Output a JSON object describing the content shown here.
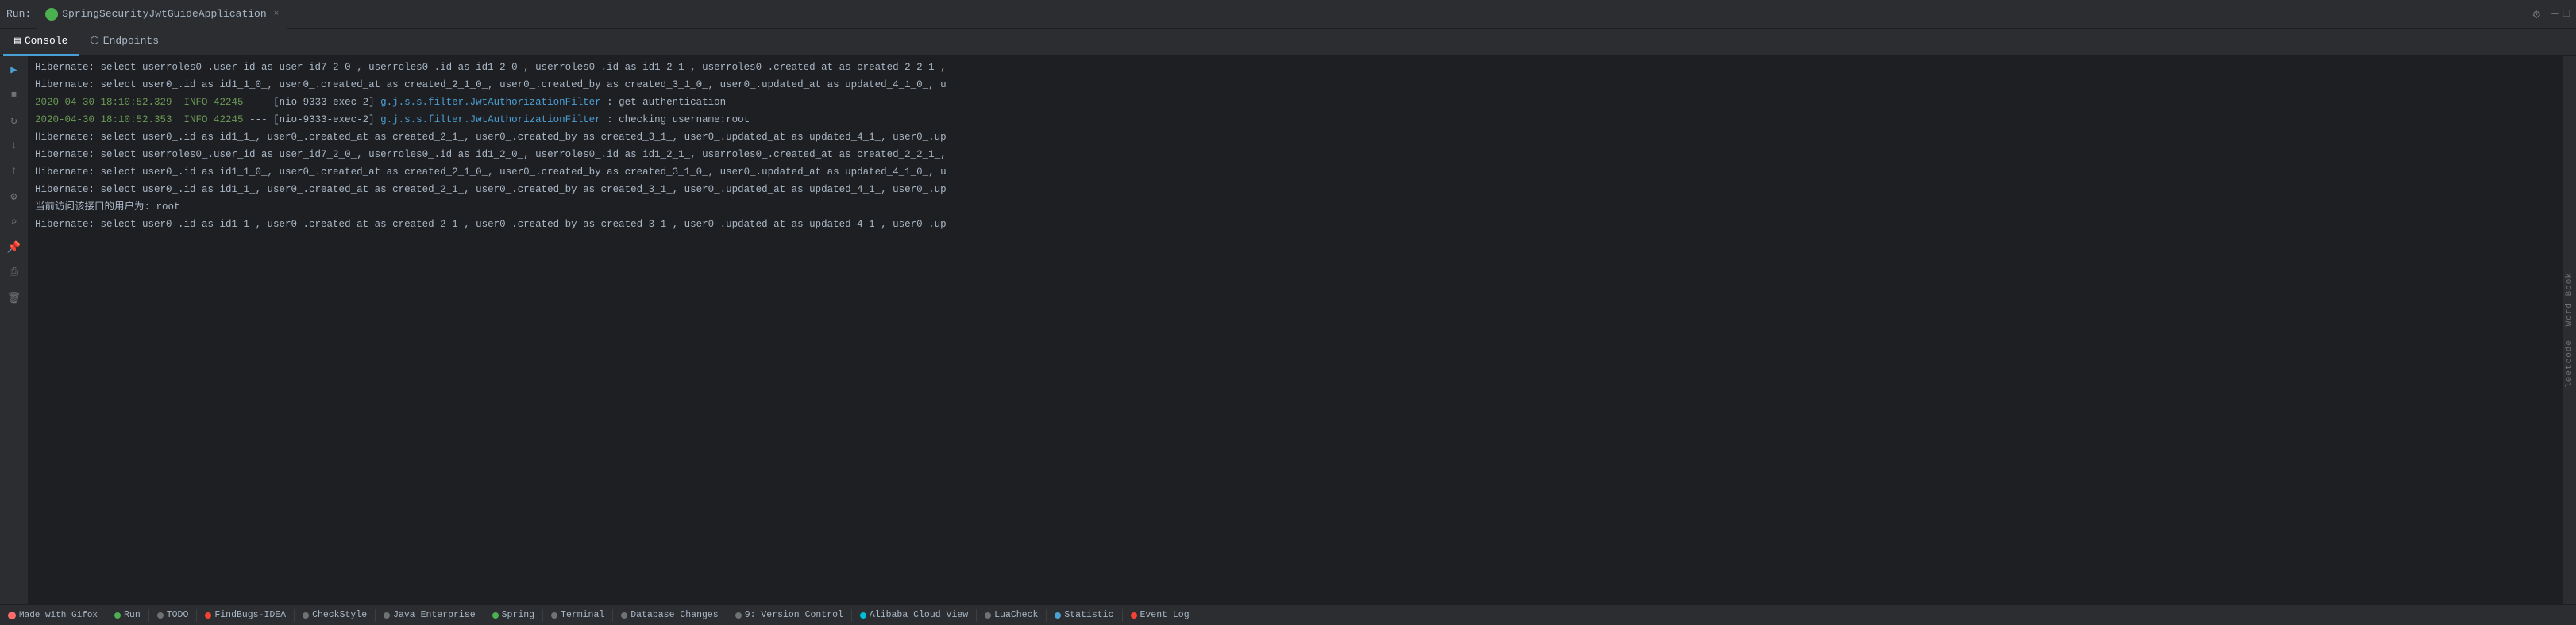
{
  "topbar": {
    "run_label": "Run:",
    "app_name": "SpringSecurityJwtGuideApplication",
    "close_label": "×",
    "gear_label": "⚙",
    "minimize_label": "—",
    "minimize2_label": "□"
  },
  "tabs": [
    {
      "id": "console",
      "label": "Console",
      "icon": "📋",
      "active": true
    },
    {
      "id": "endpoints",
      "label": "Endpoints",
      "icon": "🔗",
      "active": false
    }
  ],
  "sidebar_icons": [
    {
      "id": "run",
      "symbol": "▶",
      "active": true
    },
    {
      "id": "stop",
      "symbol": "⏹"
    },
    {
      "id": "rerun",
      "symbol": "🔄"
    },
    {
      "id": "scroll",
      "symbol": "↓"
    },
    {
      "id": "up",
      "symbol": "↑"
    },
    {
      "id": "filter",
      "symbol": "⚙"
    },
    {
      "id": "search",
      "symbol": "🔍"
    },
    {
      "id": "pin",
      "symbol": "📌"
    },
    {
      "id": "print",
      "symbol": "🖨"
    },
    {
      "id": "trash",
      "symbol": "🗑"
    }
  ],
  "log_lines": [
    {
      "type": "hibernate",
      "text": "Hibernate: select userroles0_.user_id as user_id7_2_0_, userroles0_.id as id1_2_0_, userroles0_.id as id1_2_1_, userroles0_.created_at as created_2_2_1_,"
    },
    {
      "type": "hibernate",
      "text": "Hibernate: select user0_.id as id1_1_0_, user0_.created_at as created_2_1_0_, user0_.created_by as created_3_1_0_, user0_.updated_at as updated_4_1_0_, u"
    },
    {
      "type": "info",
      "timestamp": "2020-04-30 18:10:52.329",
      "level": "INFO",
      "pid": "42245",
      "sep": "---",
      "thread": "[nio-9333-exec-2]",
      "logger": "g.j.s.s.filter.JwtAuthorizationFilter",
      "colon": ":",
      "message": " get authentication"
    },
    {
      "type": "info",
      "timestamp": "2020-04-30 18:10:52.353",
      "level": "INFO",
      "pid": "42245",
      "sep": "---",
      "thread": "[nio-9333-exec-2]",
      "logger": "g.j.s.s.filter.JwtAuthorizationFilter",
      "colon": ":",
      "message": " checking username:root"
    },
    {
      "type": "hibernate",
      "text": "Hibernate: select user0_.id as id1_1_, user0_.created_at as created_2_1_, user0_.created_by as created_3_1_, user0_.updated_at as updated_4_1_, user0_.up"
    },
    {
      "type": "hibernate",
      "text": "Hibernate: select userroles0_.user_id as user_id7_2_0_, userroles0_.id as id1_2_0_, userroles0_.id as id1_2_1_, userroles0_.created_at as created_2_2_1_,"
    },
    {
      "type": "hibernate",
      "text": "Hibernate: select user0_.id as id1_1_0_, user0_.created_at as created_2_1_0_, user0_.created_by as created_3_1_0_, user0_.updated_at as updated_4_1_0_, u"
    },
    {
      "type": "hibernate",
      "text": "Hibernate: select user0_.id as id1_1_, user0_.created_at as created_2_1_, user0_.created_by as created_3_1_, user0_.updated_at as updated_4_1_, user0_.up"
    },
    {
      "type": "plain",
      "text": "当前访问该接口的用户为: root"
    },
    {
      "type": "hibernate",
      "text": "Hibernate: select user0_.id as id1_1_, user0_.created_at as created_2_1_, user0_.created_by as created_3_1_, user0_.updated_at as updated_4_1_, user0_.up"
    }
  ],
  "right_panel": {
    "word_book": "Word Book",
    "leetcode": "leetcode"
  },
  "bottom_bar": {
    "gifox": "Made with Gifox",
    "items": [
      {
        "id": "run",
        "dot": "green",
        "label": "Run"
      },
      {
        "id": "todo",
        "dot": "gray",
        "label": "TODO"
      },
      {
        "id": "findbugs",
        "dot": "red",
        "label": "FindBugs-IDEA"
      },
      {
        "id": "checkstyle",
        "dot": "gray",
        "label": "CheckStyle"
      },
      {
        "id": "java-enterprise",
        "dot": "gray",
        "label": "Java Enterprise"
      },
      {
        "id": "spring",
        "dot": "gray",
        "label": "Spring"
      },
      {
        "id": "terminal",
        "dot": "gray",
        "label": "Terminal"
      },
      {
        "id": "db-changes",
        "dot": "gray",
        "label": "Database Changes"
      },
      {
        "id": "version-control",
        "dot": "gray",
        "label": "9: Version Control"
      },
      {
        "id": "alibaba",
        "dot": "cyan",
        "label": "Alibaba Cloud View"
      },
      {
        "id": "luacheck",
        "dot": "gray",
        "label": "LuaCheck"
      },
      {
        "id": "statistic",
        "dot": "blue",
        "label": "Statistic"
      },
      {
        "id": "event-log",
        "dot": "red",
        "label": "Event Log"
      }
    ]
  }
}
